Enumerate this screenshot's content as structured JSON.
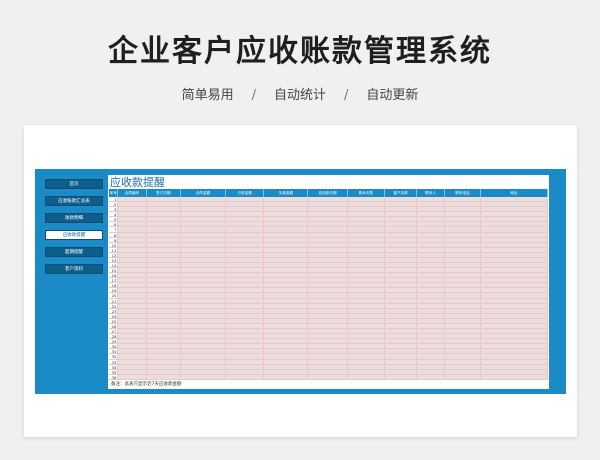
{
  "headline": "企业客户应收账款管理系统",
  "features": [
    "简单易用",
    "自动统计",
    "自动更新"
  ],
  "feature_separator": "/",
  "sidebar": {
    "items": [
      {
        "label": "首页",
        "active": false
      },
      {
        "label": "应收账款汇总表",
        "active": false
      },
      {
        "label": "收款明细",
        "active": false
      },
      {
        "label": "应收款提醒",
        "active": true
      },
      {
        "label": "超期提醒",
        "active": false
      },
      {
        "label": "客户资料",
        "active": false
      }
    ]
  },
  "sheet": {
    "title": "应收款提醒",
    "columns": [
      "序号",
      "合同编号",
      "签订日期",
      "合同金额",
      "已收金额",
      "欠款金额",
      "应还款日期",
      "剩余天数",
      "客户名称",
      "联系人",
      "联系电话",
      "地址"
    ],
    "row_count": 36,
    "footnote": "备注：此表只显示近7天应收款金额"
  },
  "colors": {
    "accent": "#1a8bc6",
    "nav_dark": "#0e5e8c",
    "cell_fill": "#ecdcdc"
  }
}
